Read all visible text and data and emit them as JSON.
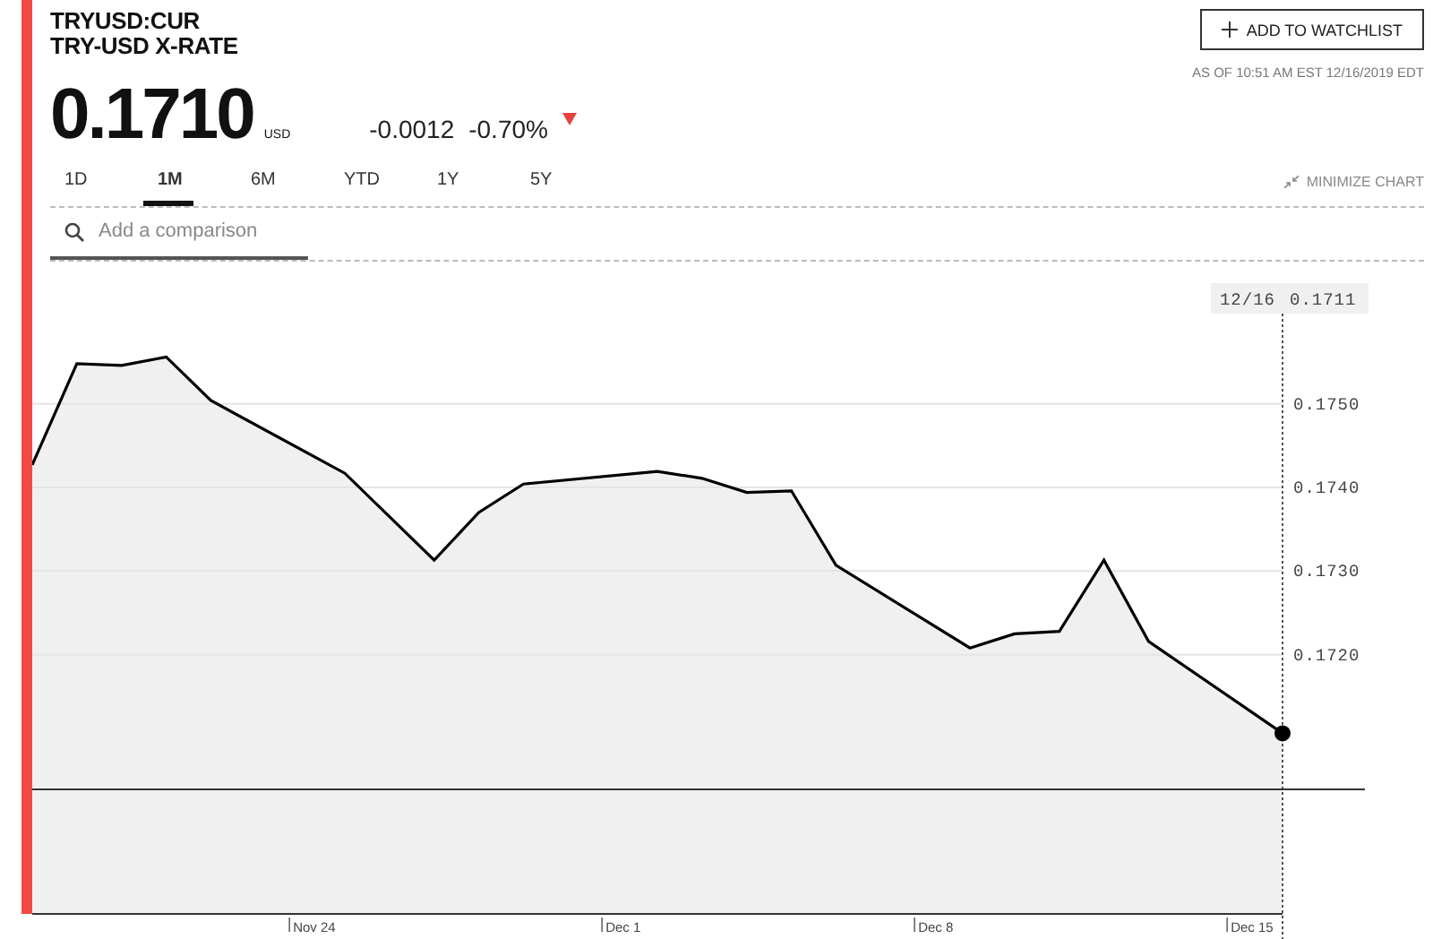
{
  "header": {
    "ticker": "TRYUSD:CUR",
    "name": "TRY-USD X-RATE",
    "price": "0.1710",
    "currency": "USD",
    "change": "-0.0012",
    "change_percent": "-0.70%",
    "falling": true
  },
  "watchlist_button": {
    "label": "ADD TO WATCHLIST"
  },
  "timestamp": "AS OF 10:51 AM EST 12/16/2019 EDT",
  "range_tabs": [
    {
      "label": "1D",
      "selected": false
    },
    {
      "label": "1M",
      "selected": true
    },
    {
      "label": "6M",
      "selected": false
    },
    {
      "label": "YTD",
      "selected": false
    },
    {
      "label": "1Y",
      "selected": false
    },
    {
      "label": "5Y",
      "selected": false
    }
  ],
  "minimize_chart": "MINIMIZE CHART",
  "comparison_search": {
    "placeholder": "Add a comparison"
  },
  "crosshair": {
    "date": "12/16",
    "value": "0.1711"
  },
  "chart": {
    "chart_data": {
      "type": "area",
      "categories": [
        null,
        null,
        null,
        null,
        null,
        null,
        "Nov 24",
        null,
        null,
        null,
        null,
        null,
        null,
        "Dec 1",
        null,
        null,
        null,
        null,
        null,
        null,
        "Dec 8",
        null,
        null,
        null,
        null,
        null,
        null,
        "Dec 15",
        null
      ],
      "series": [
        {
          "color": "#000000",
          "values": [
            0.17427,
            0.17548,
            0.17546,
            0.17556,
            0.17504,
            null,
            null,
            0.17417,
            null,
            0.17313,
            0.1737,
            0.17404,
            null,
            null,
            0.17419,
            0.17411,
            0.17394,
            0.17396,
            0.17307,
            null,
            null,
            0.17208,
            0.17225,
            0.17228,
            0.17313,
            0.17216,
            null,
            null,
            0.17106
          ]
        }
      ],
      "ylim": [
        0.1689,
        0.1764
      ],
      "grid": true,
      "yticks": [
        {
          "value": 0.175,
          "label": "0.1750"
        },
        {
          "value": 0.174,
          "label": "0.1740"
        },
        {
          "value": 0.173,
          "label": "0.1730"
        },
        {
          "value": 0.172,
          "label": "0.1720"
        }
      ]
    }
  }
}
